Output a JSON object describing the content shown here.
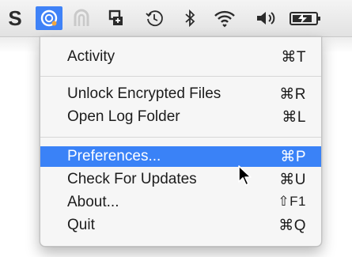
{
  "menubar": {
    "icons": [
      {
        "name": "scrivener-icon",
        "glyph": "S"
      },
      {
        "name": "app-status-icon",
        "glyph": "◎"
      },
      {
        "name": "arch-icon",
        "glyph": ""
      },
      {
        "name": "dropbox-style-icon",
        "glyph": ""
      },
      {
        "name": "time-machine-icon",
        "glyph": ""
      },
      {
        "name": "bluetooth-icon",
        "glyph": "∦"
      },
      {
        "name": "wifi-icon",
        "glyph": ""
      },
      {
        "name": "volume-icon",
        "glyph": ""
      },
      {
        "name": "battery-icon",
        "glyph": ""
      }
    ]
  },
  "menu": {
    "items": [
      {
        "label": "Activity",
        "shortcut": "⌘T",
        "selected": false
      },
      {
        "label": "Unlock Encrypted Files",
        "shortcut": "⌘R",
        "selected": false
      },
      {
        "label": "Open Log Folder",
        "shortcut": "⌘L",
        "selected": false
      },
      {
        "label": "Preferences...",
        "shortcut": "⌘P",
        "selected": true
      },
      {
        "label": "Check For Updates",
        "shortcut": "⌘U",
        "selected": false
      },
      {
        "label": "About...",
        "shortcut": "⇧F1",
        "selected": false
      },
      {
        "label": "Quit",
        "shortcut": "⌘Q",
        "selected": false
      }
    ]
  },
  "colors": {
    "selection": "#3a82f7",
    "menu_bg": "#f6f6f6"
  }
}
